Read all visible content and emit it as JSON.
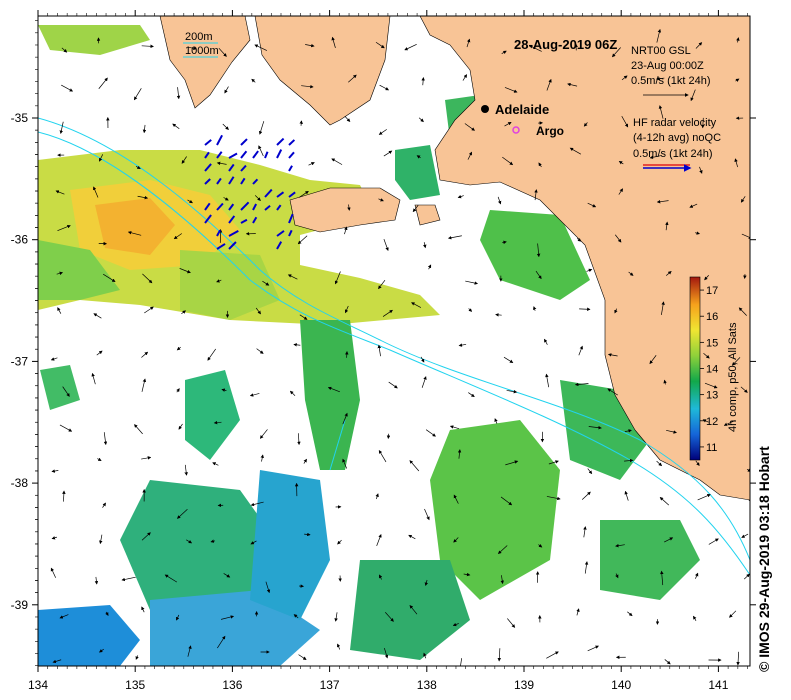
{
  "title": "28-Aug-2019 06Z",
  "scale_legend": {
    "line1": "200m",
    "line2": "1000m"
  },
  "model_legend": {
    "line1": "NRT00 GSL",
    "line2": "23-Aug 00:00Z",
    "line3": "0.5m/s (1kt 24h)"
  },
  "radar_legend": {
    "line1": "HF radar velocity",
    "line2": "(4-12h avg) noQC",
    "line3": "0.5m/s (1kt 24h)"
  },
  "places": {
    "city": "Adelaide",
    "float": "Argo"
  },
  "colorbar": {
    "label": "4h comp, p50, All Sats",
    "ticks": [
      "11",
      "12",
      "13",
      "14",
      "15",
      "16",
      "17"
    ],
    "min": 10.5,
    "max": 17.5
  },
  "axes": {
    "x_ticks": [
      "134",
      "135",
      "136",
      "137",
      "138",
      "139",
      "140",
      "141"
    ],
    "y_ticks": [
      "-35",
      "-36",
      "-37",
      "-38",
      "-39"
    ]
  },
  "credit": "© IMOS 29-Aug-2019 03:18 Hobart",
  "colors": {
    "land": "#f8c496",
    "sea_bg": "#ffffff",
    "shelf_line": "#22d3ee",
    "radar_vectors": "#0000cc"
  }
}
